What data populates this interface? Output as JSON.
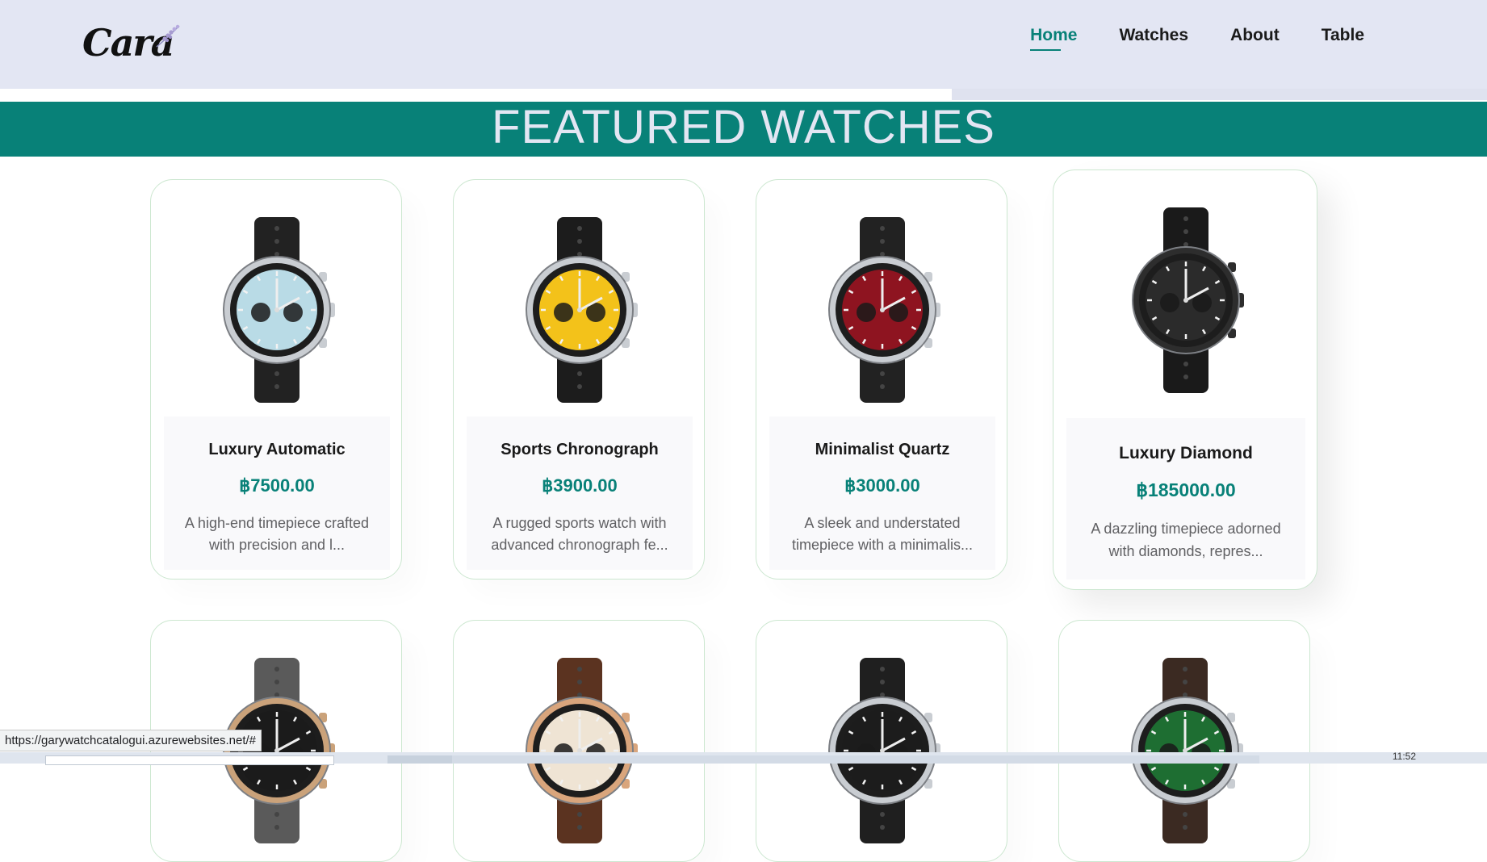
{
  "header": {
    "logo_text": "Cara",
    "nav": [
      {
        "label": "Home",
        "active": true
      },
      {
        "label": "Watches",
        "active": false
      },
      {
        "label": "About",
        "active": false
      },
      {
        "label": "Table",
        "active": false
      }
    ],
    "scroll_progress": 0.64
  },
  "banner": {
    "title": "FEATURED WATCHES"
  },
  "products": [
    {
      "name": "Luxury Automatic",
      "price": "฿7500.00",
      "desc": "A high-end timepiece crafted with precision and l...",
      "dial": "#b9dbe6",
      "strap": "#222222",
      "case": "#c9cdd2"
    },
    {
      "name": "Sports Chronograph",
      "price": "฿3900.00",
      "desc": "A rugged sports watch with advanced chronograph fe...",
      "dial": "#f3c21a",
      "strap": "#1c1c1c",
      "case": "#c9cdd2"
    },
    {
      "name": "Minimalist Quartz",
      "price": "฿3000.00",
      "desc": "A sleek and understated timepiece with a minimalis...",
      "dial": "#8e1420",
      "strap": "#222222",
      "case": "#c9cdd2"
    },
    {
      "name": "Luxury Diamond",
      "price": "฿185000.00",
      "desc": "A dazzling timepiece adorned with diamonds, repres...",
      "dial": "#2b2b2b",
      "strap": "#1a1a1a",
      "case": "#2d2d2d"
    }
  ],
  "row2": [
    {
      "dial": "#1b1b1b",
      "strap": "#5a5a5a",
      "case": "#caa27a"
    },
    {
      "dial": "#efe4d4",
      "strap": "#5b3320",
      "case": "#d9a57c"
    },
    {
      "dial": "#1c1c1c",
      "strap": "#1f1f1f",
      "case": "#c9cdd2"
    },
    {
      "dial": "#1e6e32",
      "strap": "#3b2a22",
      "case": "#c9cdd2"
    }
  ],
  "status": {
    "url": "https://garywatchcatalogui.azurewebsites.net/#"
  },
  "taskbar": {
    "clock": "11:52"
  }
}
